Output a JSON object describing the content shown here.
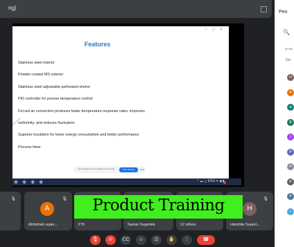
{
  "window": {
    "title": "ng)"
  },
  "slide": {
    "corner_controls": "− □ ×",
    "title": "Features",
    "bullets": [
      "Stainless steel interior",
      "Powder-coated MS exterior",
      "Stainless steel adjustable perforated shelve",
      "PID controller for precise temperature control",
      "Forced air convection produces faster temperature response rates, improves",
      "uniformity, and reduces fluctuation",
      "Superior insulation for lower energy consumption and better performance",
      "Process timer"
    ],
    "notification": {
      "text": "meet.google.com is sharing your screen.",
      "stop_label": "Stop sharing",
      "hide_label": "Hide"
    },
    "taskbar": {
      "apps": "◉ ◉ ◉ ◉",
      "tray": "^ ☁ ◻ ENG ▾ ◀ ▮"
    }
  },
  "tiles": [
    {
      "name": "",
      "avatar": "",
      "avatar_color": ""
    },
    {
      "name": "Abhishek super...",
      "avatar": "A",
      "avatar_color": "#e8710a"
    },
    {
      "name": "P B",
      "avatar": "",
      "avatar_color": ""
    },
    {
      "name": "Samar Supertek",
      "avatar": "",
      "avatar_color": ""
    },
    {
      "name": "12 others",
      "avatar": "",
      "avatar_color": ""
    },
    {
      "name": "Harshita Supert...",
      "avatar": "H",
      "avatar_color": "#7e5e60"
    }
  ],
  "overlay": {
    "text": "Product Training",
    "color": "#3fef1e"
  },
  "controls": [
    {
      "name": "mic-off",
      "glyph": "🎙",
      "red": true
    },
    {
      "name": "camera-off",
      "glyph": "⊘",
      "red": true
    },
    {
      "name": "captions",
      "glyph": "CC",
      "red": false
    },
    {
      "name": "emoji",
      "glyph": "☺",
      "red": false
    },
    {
      "name": "present",
      "glyph": "⊡",
      "red": false
    },
    {
      "name": "raise-hand",
      "glyph": "✋",
      "red": false
    },
    {
      "name": "more",
      "glyph": "⋮",
      "red": false
    },
    {
      "name": "leave-call",
      "glyph": "☎",
      "red": true
    }
  ],
  "panel": {
    "title": "Peo",
    "search_glyph": "🔍",
    "section": "IN ME",
    "contributors": "Co",
    "participants": [
      {
        "initial": "H",
        "color": "#7e5e60"
      },
      {
        "initial": "A",
        "color": "#e8710a"
      },
      {
        "initial": "a",
        "color": "#12857e"
      },
      {
        "initial": "B",
        "color": "#1e7a55"
      },
      {
        "initial": "J",
        "color": "#a142f4"
      },
      {
        "initial": "P",
        "color": "#5c6bc0"
      },
      {
        "initial": "P",
        "color": "#8a8f98"
      },
      {
        "initial": "P",
        "color": "#5f6368"
      },
      {
        "initial": "P",
        "color": "#4a7aa0"
      },
      {
        "initial": "r",
        "color": "#4aa8e0"
      }
    ]
  }
}
